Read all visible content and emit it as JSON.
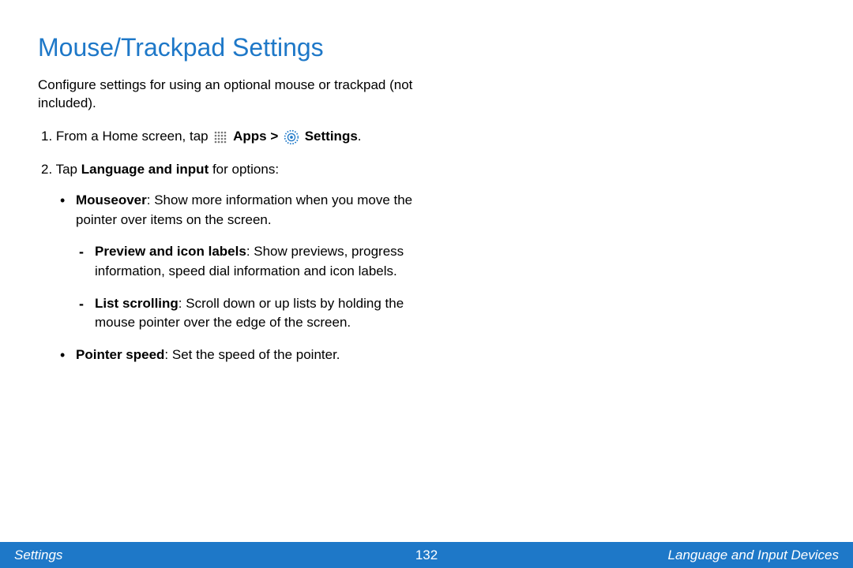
{
  "title": "Mouse/Trackpad Settings",
  "intro": "Configure settings for using an optional mouse or trackpad (not included).",
  "step1": {
    "prefix": "1.  From a Home screen, tap ",
    "apps": "Apps > ",
    "settings": "Settings",
    "period": "."
  },
  "step2": {
    "prefix": "2.  Tap ",
    "bold": "Language and input",
    "suffix": " for options:"
  },
  "bullets": {
    "mouseover": {
      "label": "Mouseover",
      "text": ": Show more information when you move the pointer over items on the screen."
    },
    "preview": {
      "label": "Preview and icon labels",
      "text": ": Show previews, progress information, speed dial information and icon labels."
    },
    "listscroll": {
      "label": "List scrolling",
      "text": ": Scroll down or up lists by holding the mouse pointer over the edge of the screen."
    },
    "pointer": {
      "label": "Pointer speed",
      "text": ": Set the speed of the pointer."
    }
  },
  "footer": {
    "left": "Settings",
    "page": "132",
    "right": "Language and Input Devices"
  }
}
